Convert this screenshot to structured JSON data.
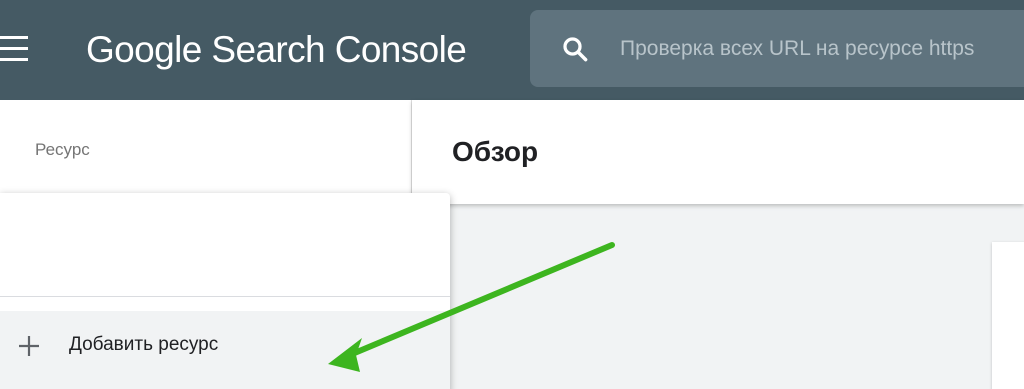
{
  "header": {
    "app_title": "Google Search Console",
    "menu_icon": "hamburger-menu-icon",
    "search": {
      "icon": "search-icon",
      "placeholder": "Проверка всех URL на ресурсе https"
    }
  },
  "sidebar": {
    "label": "Ресурс"
  },
  "main": {
    "title": "Обзор"
  },
  "dropdown": {
    "add_resource_icon": "plus-icon",
    "add_resource_label": "Добавить ресурс"
  },
  "annotation": {
    "arrow_color": "#3db51f"
  },
  "colors": {
    "topbar": "#455a64",
    "search_box": "#5f737e"
  }
}
